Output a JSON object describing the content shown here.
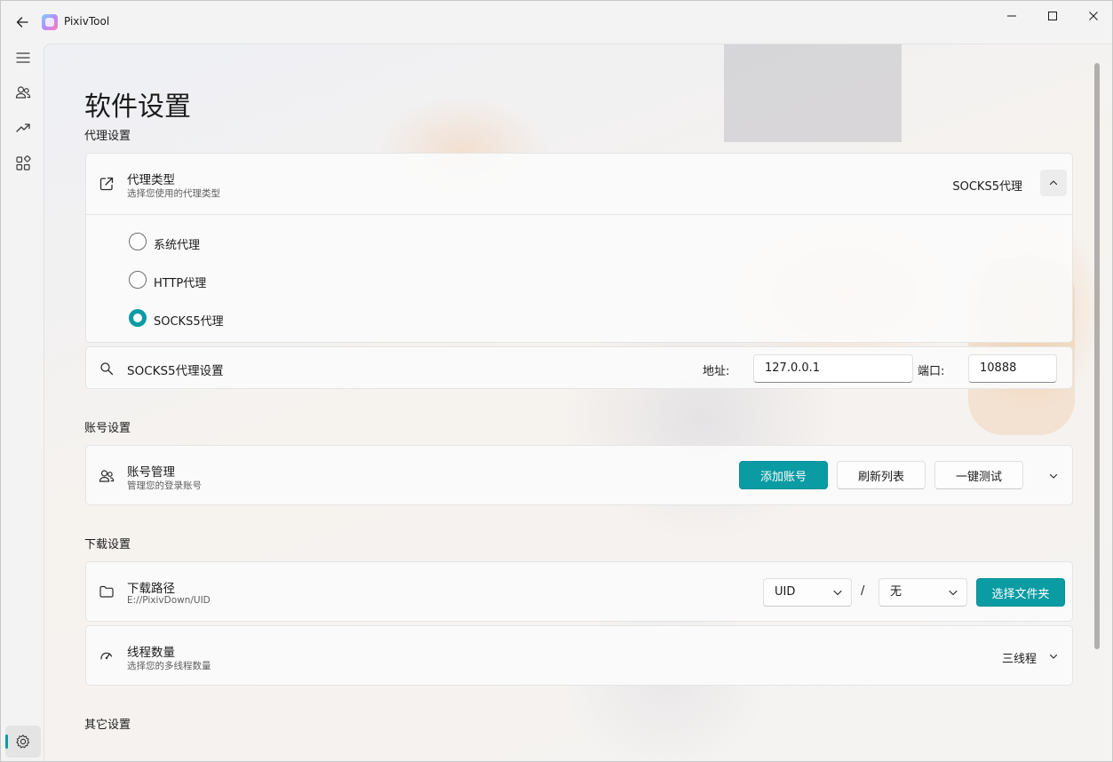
{
  "app": {
    "title": "PixivTool"
  },
  "page": {
    "title": "软件设置"
  },
  "sections": {
    "proxy": "代理设置",
    "account": "账号设置",
    "download": "下载设置",
    "other": "其它设置"
  },
  "proxy_type": {
    "title": "代理类型",
    "subtitle": "选择您使用的代理类型",
    "value": "SOCKS5代理",
    "options": [
      "系统代理",
      "HTTP代理",
      "SOCKS5代理"
    ],
    "selected_index": 2
  },
  "socks5": {
    "title": "SOCKS5代理设置",
    "address_label": "地址:",
    "address_value": "127.0.0.1",
    "port_label": "端口:",
    "port_value": "10888"
  },
  "account_manage": {
    "title": "账号管理",
    "subtitle": "管理您的登录账号",
    "add_label": "添加账号",
    "refresh_label": "刷新列表",
    "test_label": "一键测试"
  },
  "download_path": {
    "title": "下载路径",
    "subtitle": "E://PixivDown/UID",
    "combo1_value": "UID",
    "separator": "/",
    "combo2_value": "无",
    "choose_label": "选择文件夹"
  },
  "threads": {
    "title": "线程数量",
    "subtitle": "选择您的多线程数量",
    "value": "三线程"
  },
  "colors": {
    "accent": "#0a9ba3"
  },
  "icons": {
    "back": "arrow-left-icon",
    "menu": "hamburger-icon",
    "accounts": "people-icon",
    "trend": "trending-up-icon",
    "apps": "apps-grid-icon",
    "settings": "gear-icon",
    "proxy": "open-external-icon",
    "socks": "search-icon",
    "account": "people-icon",
    "folder": "folder-icon",
    "threads": "gauge-icon"
  }
}
